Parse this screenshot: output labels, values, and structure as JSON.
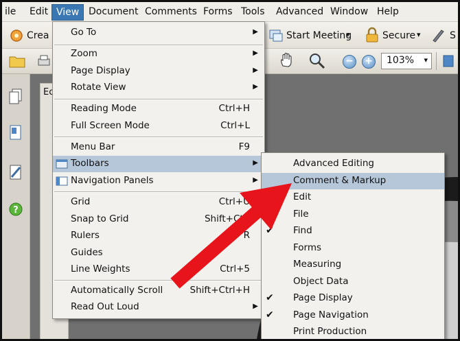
{
  "menubar": {
    "items": [
      "ile",
      "Edit",
      "View",
      "Document",
      "Comments",
      "Forms",
      "Tools",
      "Advanced",
      "Window",
      "Help"
    ],
    "active": "View"
  },
  "toolbar1": {
    "create_label": "Crea",
    "start_meeting_label": "Start Meeting",
    "secure_label": "Secure",
    "dropdown_glyph": "▾"
  },
  "toolbar2": {
    "zoom_value": "103%",
    "zoom_out_glyph": "−",
    "zoom_in_glyph": "+"
  },
  "doc_tab_label": "Ec",
  "view_menu": {
    "items": [
      {
        "label": "Go To",
        "shortcut": "",
        "submenu": true
      },
      {
        "label": "Zoom",
        "shortcut": "",
        "submenu": true
      },
      {
        "label": "Page Display",
        "shortcut": "",
        "submenu": true
      },
      {
        "label": "Rotate View",
        "shortcut": "",
        "submenu": true
      },
      {
        "label": "Reading Mode",
        "shortcut": "Ctrl+H",
        "submenu": false
      },
      {
        "label": "Full Screen Mode",
        "shortcut": "Ctrl+L",
        "submenu": false
      },
      {
        "label": "Menu Bar",
        "shortcut": "F9",
        "submenu": false
      },
      {
        "label": "Toolbars",
        "shortcut": "",
        "submenu": true,
        "highlighted": true
      },
      {
        "label": "Navigation Panels",
        "shortcut": "",
        "submenu": true
      },
      {
        "label": "Grid",
        "shortcut": "Ctrl+U",
        "submenu": false
      },
      {
        "label": "Snap to Grid",
        "shortcut": "Shift+Ctrl",
        "submenu": false
      },
      {
        "label": "Rulers",
        "shortcut": "R",
        "submenu": false
      },
      {
        "label": "Guides",
        "shortcut": "",
        "submenu": false
      },
      {
        "label": "Line Weights",
        "shortcut": "Ctrl+5",
        "submenu": false
      },
      {
        "label": "Automatically Scroll",
        "shortcut": "Shift+Ctrl+H",
        "submenu": false
      },
      {
        "label": "Read Out Loud",
        "shortcut": "",
        "submenu": true
      }
    ],
    "arrow_glyph": "▶"
  },
  "toolbars_submenu": {
    "items": [
      {
        "label": "Advanced Editing",
        "checked": false
      },
      {
        "label": "Comment & Markup",
        "checked": false,
        "highlighted": true
      },
      {
        "label": "Edit",
        "checked": false
      },
      {
        "label": "File",
        "checked": true
      },
      {
        "label": "Find",
        "checked": true
      },
      {
        "label": "Forms",
        "checked": false
      },
      {
        "label": "Measuring",
        "checked": false
      },
      {
        "label": "Object Data",
        "checked": false
      },
      {
        "label": "Page Display",
        "checked": true
      },
      {
        "label": "Page Navigation",
        "checked": true
      },
      {
        "label": "Print Production",
        "checked": false
      }
    ],
    "check_glyph": "✔"
  },
  "colors": {
    "arrow_red": "#e8141b",
    "menu_highlight": "#b7c7da",
    "menubar_active": "#3b77b3"
  }
}
